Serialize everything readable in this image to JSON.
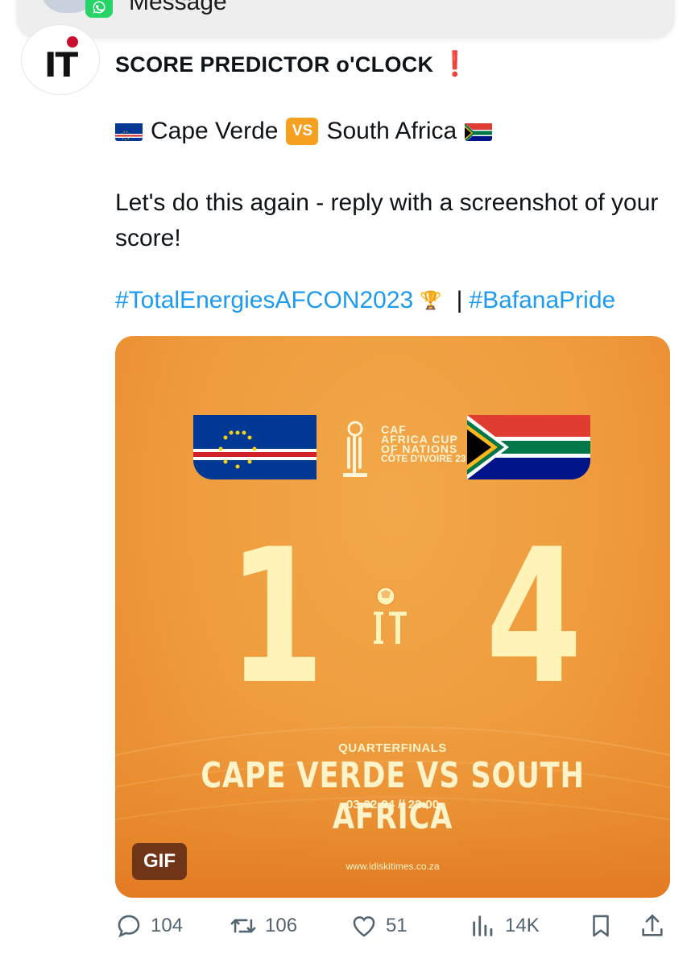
{
  "notification": {
    "text": "Message"
  },
  "post": {
    "author_logo": "IT",
    "title": "SCORE PREDICTOR o'CLOCK",
    "title_emoji": "❗",
    "matchup_line": {
      "home_team": "Cape Verde",
      "vs": "VS",
      "away_team": "South Africa"
    },
    "body": "Let's do this again - reply with a screenshot of your score!",
    "hashtags": [
      "#TotalEnergiesAFCON2023",
      "#BafanaPride"
    ],
    "hashtag_separator": "|"
  },
  "media": {
    "competition": {
      "caf": "CAF",
      "name_line1": "AFRICA CUP",
      "name_line2": "OF NATIONS",
      "host": "CÔTE D'IVOIRE 23"
    },
    "home_score": "1",
    "away_score": "4",
    "center_logo": "IT",
    "round": "QUARTERFINALS",
    "matchup": "CAPE VERDE VS SOUTH AFRICA",
    "datetime": "03-02-24 // 22:00",
    "website": "www.idiskitimes.co.za",
    "badge": "GIF"
  },
  "actions": {
    "replies": "104",
    "retweets": "106",
    "likes": "51",
    "views": "14K"
  },
  "colors": {
    "accent": "#1d9bf0",
    "media_orange": "#ee9b3c",
    "score_text": "#fff3b8",
    "icon_gray": "#536471"
  }
}
